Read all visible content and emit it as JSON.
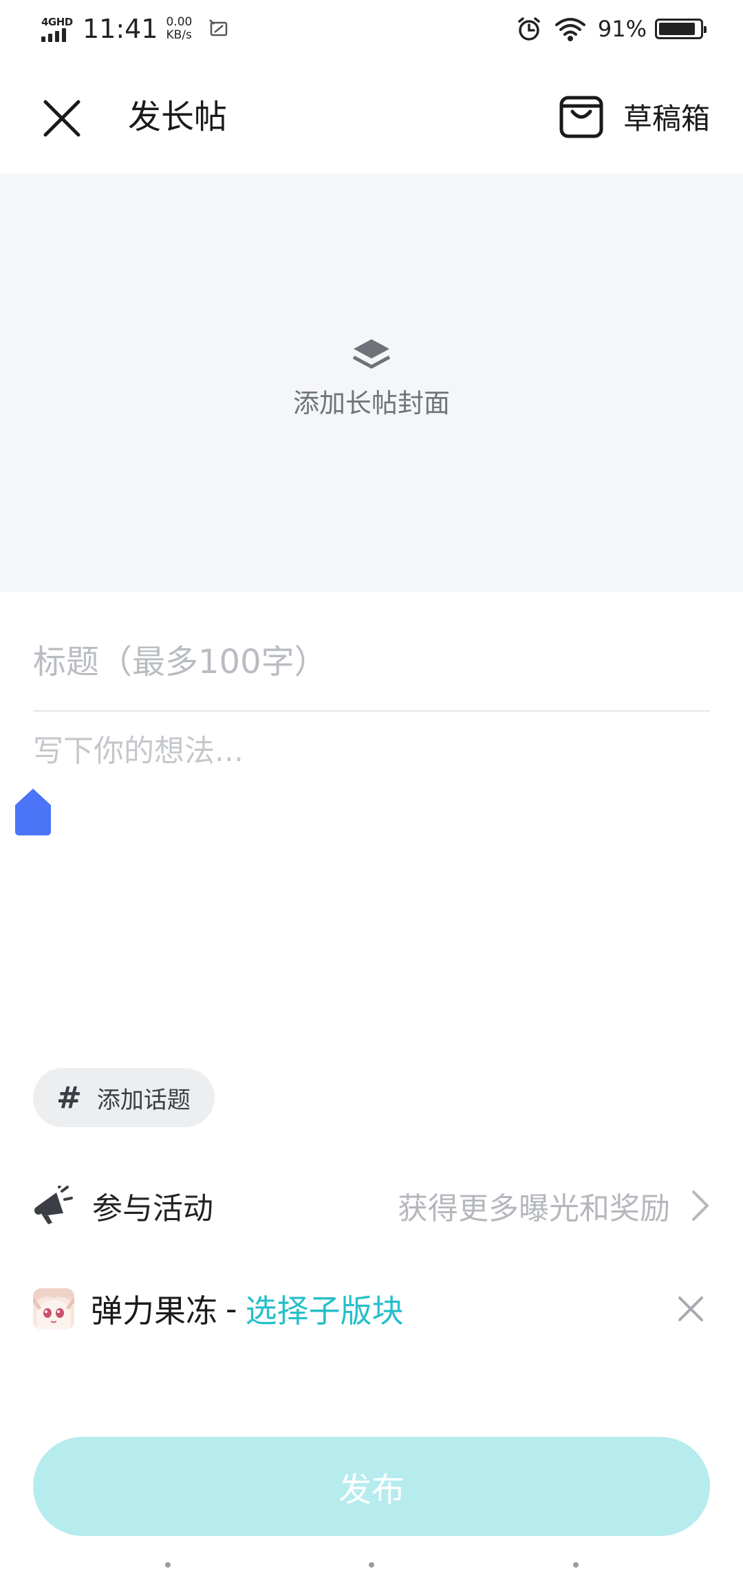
{
  "status_bar": {
    "network": "4GHD",
    "time": "11:41",
    "speed_value": "0.00",
    "speed_unit": "KB/s",
    "battery_percent": "91%",
    "battery_level": 0.91,
    "icons": [
      "signal-icon",
      "screenshot-icon",
      "alarm-icon",
      "wifi-icon",
      "battery-icon"
    ]
  },
  "header": {
    "title": "发长帖",
    "drafts_label": "草稿箱",
    "icons": [
      "close-icon",
      "drafts-box-icon"
    ]
  },
  "cover": {
    "label": "添加长帖封面",
    "icon": "layers-icon"
  },
  "editor": {
    "title_placeholder": "标题（最多100字）",
    "body_placeholder": "写下你的想法...",
    "title_value": "",
    "body_value": ""
  },
  "topic": {
    "hash": "#",
    "label": "添加话题"
  },
  "activity": {
    "label": "参与活动",
    "hint": "获得更多曝光和奖励",
    "icons": [
      "megaphone-icon",
      "chevron-right-icon"
    ]
  },
  "board": {
    "name": "弹力果冻",
    "separator": "-",
    "pick_label": "选择子版块",
    "pick_color": "#26bfc9"
  },
  "publish": {
    "label": "发布",
    "color": "#b6ecee"
  }
}
